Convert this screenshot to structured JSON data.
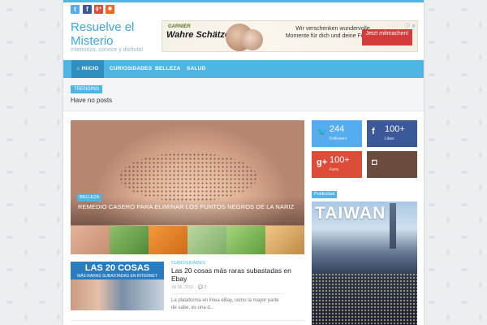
{
  "colors": {
    "accent": "#4fb5e3",
    "nav_active": "#2f8fc1",
    "twitter": "#55acee",
    "facebook": "#3b5998",
    "googleplus": "#dd4b39",
    "rss": "#f26522",
    "instagram": "#6a4b3d"
  },
  "topbar": {
    "social": [
      {
        "icon": "twitter-icon",
        "glyph": "t"
      },
      {
        "icon": "facebook-icon",
        "glyph": "f"
      },
      {
        "icon": "googleplus-icon",
        "glyph": "g+"
      },
      {
        "icon": "rss-icon",
        "glyph": "◉"
      }
    ]
  },
  "header": {
    "title": "Resuelve el Misterio",
    "tagline": "Interioriza, conoce y disfruta!"
  },
  "ad": {
    "brand": "GARNIER",
    "headline": "Wahre Schätze",
    "text": "Wir verschenken wundervolle Momente für dich und deine Freundin",
    "button": "Jetzt mitmachen!",
    "close": "ⓘ ✕"
  },
  "nav": {
    "items": [
      {
        "label": "INICIO",
        "icon": "home-icon"
      },
      {
        "label": "CURIOSIDADES"
      },
      {
        "label": "BELLEZA"
      },
      {
        "label": "SALUD"
      }
    ]
  },
  "trending": {
    "label": "TRENDING",
    "text": "Have no posts"
  },
  "featured": {
    "category": "BELLEZA",
    "title": "REMEDIO CASERO PARA ELIMINAR LOS PUNTOS NEGROS DE LA NARIZ"
  },
  "social_counters": [
    {
      "icon": "twitter-icon",
      "glyph": "🐦",
      "count": "244",
      "label": "Followers",
      "color": "#55acee"
    },
    {
      "icon": "facebook-icon",
      "glyph": "f",
      "count": "100+",
      "label": "Likes",
      "color": "#3b5998"
    },
    {
      "icon": "googleplus-icon",
      "glyph": "g+",
      "count": "100+",
      "label": "Fans",
      "color": "#dd4b39"
    },
    {
      "icon": "instagram-icon",
      "glyph": "◘",
      "count": "",
      "label": "",
      "color": "#6a4b3d"
    }
  ],
  "sidebar": {
    "ad_label": "Publicidad",
    "ad_text": "TAIWAN"
  },
  "post": {
    "image_title": "LAS 20 COSAS",
    "image_subtitle": "MÁS RARAS SUBASTADAS EN INTERNET",
    "category": "CURIOSIDADES",
    "title": "Las 20 cosas más raras subastadas en Ebay",
    "date": "Jul 06, 2015",
    "comments": "💬 0",
    "excerpt": "La plataforma en línea eBay, como la mayor parte de sabe, es una d..."
  }
}
